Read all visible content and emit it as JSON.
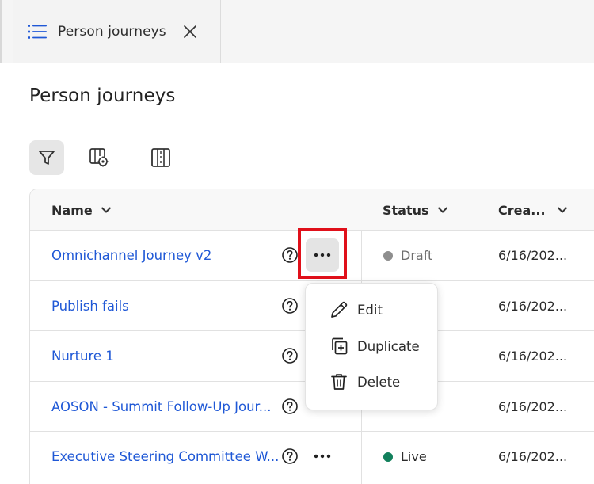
{
  "tab": {
    "label": "Person journeys",
    "icon": "list-icon",
    "close_icon": "close-icon"
  },
  "page": {
    "title": "Person journeys"
  },
  "toolbar": {
    "filter_icon": "filter-icon",
    "settings_icon": "table-settings-icon",
    "columns_icon": "columns-icon"
  },
  "table": {
    "headers": {
      "name": "Name",
      "status": "Status",
      "created": "Crea..."
    },
    "rows": [
      {
        "name": "Omnichannel Journey v2",
        "status": "Draft",
        "status_color": "#8e8e8e",
        "created": "6/16/202..."
      },
      {
        "name": "Publish fails",
        "status": "",
        "status_color": "",
        "created": "6/16/202..."
      },
      {
        "name": "Nurture 1",
        "status": "",
        "status_color": "",
        "created": "6/16/202..."
      },
      {
        "name": "AOSON - Summit Follow-Up Jour...",
        "status": "",
        "status_color": "",
        "created": "6/16/202..."
      },
      {
        "name": "Executive Steering Committee W...",
        "status": "Live",
        "status_color": "#12805c",
        "created": "6/16/202..."
      }
    ]
  },
  "context_menu": {
    "items": [
      {
        "label": "Edit",
        "icon": "pencil-icon"
      },
      {
        "label": "Duplicate",
        "icon": "duplicate-icon"
      },
      {
        "label": "Delete",
        "icon": "trash-icon"
      }
    ]
  },
  "colors": {
    "link": "#1f58d6",
    "highlight": "#e0101a",
    "live": "#12805c",
    "draft": "#8e8e8e"
  }
}
